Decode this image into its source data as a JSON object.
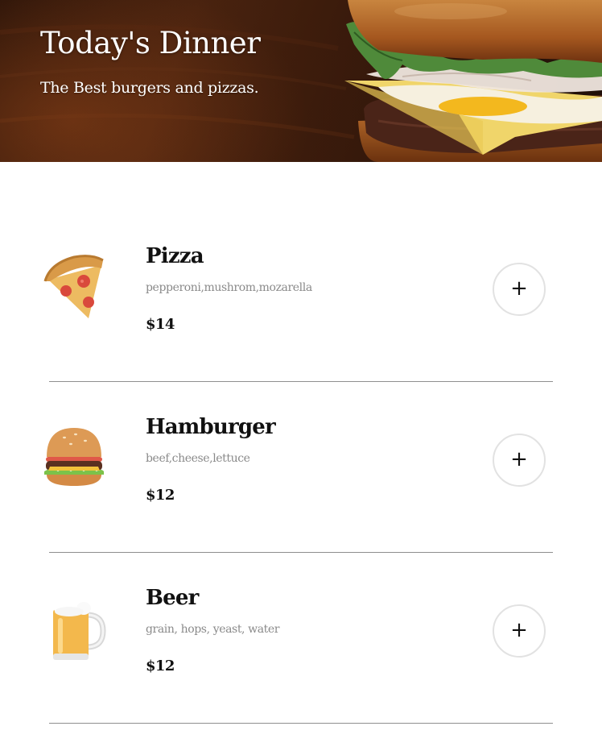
{
  "header": {
    "title": "Today's Dinner",
    "subtitle": "The Best burgers and pizzas.",
    "background_image": "burger-photo"
  },
  "menu": {
    "items": [
      {
        "name": "Pizza",
        "description": "pepperoni,mushrom,mozarella",
        "price": "$14",
        "icon": "pizza-slice-icon",
        "add_label": "+"
      },
      {
        "name": "Hamburger",
        "description": "beef,cheese,lettuce",
        "price": "$12",
        "icon": "hamburger-icon",
        "add_label": "+"
      },
      {
        "name": "Beer",
        "description": "grain, hops, yeast, water",
        "price": "$12",
        "icon": "beer-mug-icon",
        "add_label": "+"
      }
    ]
  },
  "colors": {
    "text": "#111111",
    "muted": "#8a8a8a",
    "button_border": "#e2e2e2",
    "divider": "#8f8f8f"
  }
}
